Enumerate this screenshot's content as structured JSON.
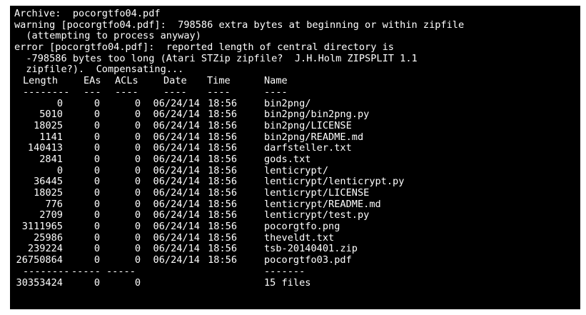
{
  "terminal": {
    "messages": [
      "Archive:  pocorgtfo04.pdf",
      "warning [pocorgtfo04.pdf]:  798586 extra bytes at beginning or within zipfile",
      "  (attempting to process anyway)",
      "error [pocorgtfo04.pdf]:  reported length of central directory is",
      "  -798586 bytes too long (Atari STZip zipfile?  J.H.Holm ZIPSPLIT 1.1",
      "  zipfile?).  Compensating..."
    ],
    "headers": {
      "length": "Length",
      "eas": "EAs",
      "acls": "ACLs",
      "date": "Date",
      "time": "Time",
      "name": "Name"
    },
    "separator": {
      "length": "--------",
      "eas": "---",
      "acls": "----",
      "date": "----",
      "time": "----",
      "name": "----"
    },
    "rows": [
      {
        "length": "0",
        "eas": "0",
        "acls": "0",
        "date": "06/24/14",
        "time": "18:56",
        "name": "bin2png/"
      },
      {
        "length": "5010",
        "eas": "0",
        "acls": "0",
        "date": "06/24/14",
        "time": "18:56",
        "name": "bin2png/bin2png.py"
      },
      {
        "length": "18025",
        "eas": "0",
        "acls": "0",
        "date": "06/24/14",
        "time": "18:56",
        "name": "bin2png/LICENSE"
      },
      {
        "length": "1141",
        "eas": "0",
        "acls": "0",
        "date": "06/24/14",
        "time": "18:56",
        "name": "bin2png/README.md"
      },
      {
        "length": "140413",
        "eas": "0",
        "acls": "0",
        "date": "06/24/14",
        "time": "18:56",
        "name": "darfsteller.txt"
      },
      {
        "length": "2841",
        "eas": "0",
        "acls": "0",
        "date": "06/24/14",
        "time": "18:56",
        "name": "gods.txt"
      },
      {
        "length": "0",
        "eas": "0",
        "acls": "0",
        "date": "06/24/14",
        "time": "18:56",
        "name": "lenticrypt/"
      },
      {
        "length": "36445",
        "eas": "0",
        "acls": "0",
        "date": "06/24/14",
        "time": "18:56",
        "name": "lenticrypt/lenticrypt.py"
      },
      {
        "length": "18025",
        "eas": "0",
        "acls": "0",
        "date": "06/24/14",
        "time": "18:56",
        "name": "lenticrypt/LICENSE"
      },
      {
        "length": "776",
        "eas": "0",
        "acls": "0",
        "date": "06/24/14",
        "time": "18:56",
        "name": "lenticrypt/README.md"
      },
      {
        "length": "2709",
        "eas": "0",
        "acls": "0",
        "date": "06/24/14",
        "time": "18:56",
        "name": "lenticrypt/test.py"
      },
      {
        "length": "3111965",
        "eas": "0",
        "acls": "0",
        "date": "06/24/14",
        "time": "18:56",
        "name": "pocorgtfo.png"
      },
      {
        "length": "25986",
        "eas": "0",
        "acls": "0",
        "date": "06/24/14",
        "time": "18:56",
        "name": "theveldt.txt"
      },
      {
        "length": "239224",
        "eas": "0",
        "acls": "0",
        "date": "06/24/14",
        "time": "18:56",
        "name": "tsb-20140401.zip"
      },
      {
        "length": "26750864",
        "eas": "0",
        "acls": "0",
        "date": "06/24/14",
        "time": "18:56",
        "name": "pocorgtfo03.pdf"
      }
    ],
    "total_separator": {
      "length": "--------",
      "eas": "-----",
      "acls": "-----",
      "name": "-------"
    },
    "totals": {
      "length": "30353424",
      "eas": "0",
      "acls": "0",
      "name": "15 files"
    }
  }
}
